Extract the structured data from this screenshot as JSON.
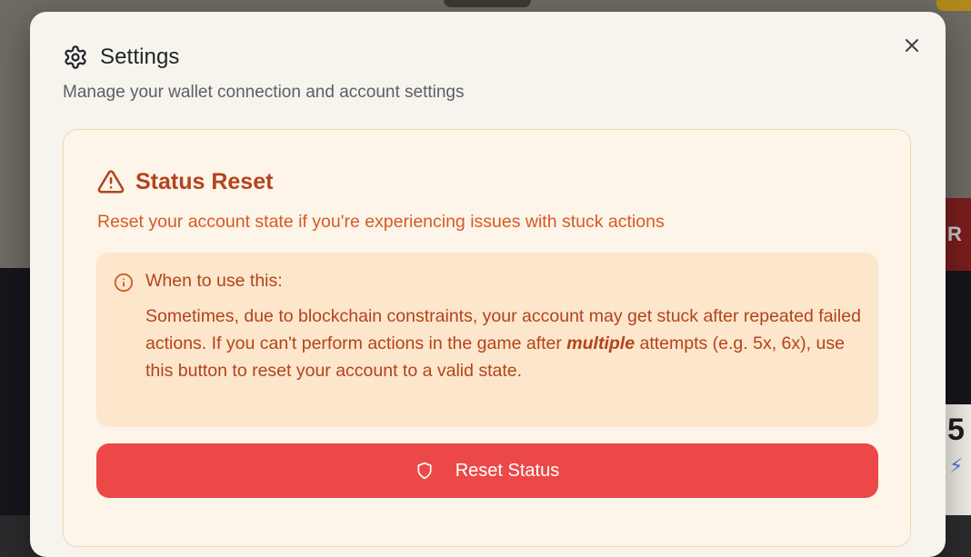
{
  "modal": {
    "title": "Settings",
    "subtitle": "Manage your wallet connection and account settings",
    "close_icon": "x-icon",
    "settings_icon": "gear-icon"
  },
  "status_reset": {
    "title": "Status Reset",
    "icon": "warning-triangle-icon",
    "description": "Reset your account state if you're experiencing issues with stuck actions",
    "info": {
      "icon": "info-circle-icon",
      "heading": "When to use this:",
      "body_before": "Sometimes, due to blockchain constraints, your account may get stuck after repeated failed actions. If you can't perform actions in the game after ",
      "body_emphasis": "multiple",
      "body_after": " attempts (e.g. 5x, 6x), use this button to reset your account to a valid state."
    },
    "button": {
      "label": "Reset Status",
      "icon": "shield-icon"
    }
  },
  "background": {
    "right_number": "5",
    "right_button_text": "R"
  },
  "colors": {
    "modal_bg": "#f6f4ec",
    "card_bg": "#fdf4ea",
    "card_border": "#f5d6b0",
    "info_bg": "#fce6cc",
    "accent_dark": "#b4431a",
    "accent": "#d55b20",
    "button_bg": "#ec4848"
  }
}
